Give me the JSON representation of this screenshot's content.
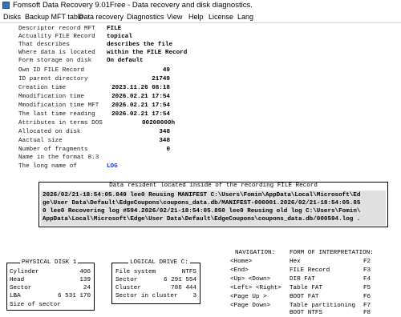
{
  "window": {
    "title": "Fomsoft Data Recovery 9.01Free - Data recovery and disk diagnostics."
  },
  "menu": [
    "Disks",
    "Backup MFT table",
    "Data recovery",
    "Diagnostics",
    "View",
    "Help",
    "License",
    "Lang"
  ],
  "record": {
    "descriptor_record_mft": {
      "label": "Descriptor record MFT",
      "value": "FILE"
    },
    "actuality": {
      "label": "Actuality FILE Record",
      "value": "topical"
    },
    "that_describes": {
      "label": "That describes",
      "value": "describes the file"
    },
    "where_located": {
      "label": "Where data is located",
      "value": "within the FILE Record"
    },
    "form_storage": {
      "label": "Form storage on disk",
      "value": "On default"
    },
    "own_id": {
      "label": "Own ID FILE Record",
      "value": "49"
    },
    "parent_dir": {
      "label": "ID parent directory",
      "value": "21749"
    },
    "creation_time": {
      "label": "Creation time",
      "value": "2023.11.26 08:18"
    },
    "mod_time": {
      "label": "Mmodification time",
      "value": "2026.02.21 17:54"
    },
    "mod_time_mft": {
      "label": "Mmodification time MFT",
      "value": "2026.02.21 17:54"
    },
    "last_reading": {
      "label": "The last time reading",
      "value": "2026.02.21 17:54"
    },
    "attributes_dos": {
      "label": "Attributes in terms DOS",
      "value": "00200000h"
    },
    "allocated": {
      "label": "Allocated on disk",
      "value": "348"
    },
    "actual_size": {
      "label": "Aactual size",
      "value": "348"
    },
    "fragments": {
      "label": "Number of fragments",
      "value": "0"
    },
    "name_8_3": {
      "label": "Name in the format 8.3",
      "value": ""
    },
    "long_name": {
      "label": "The long name of",
      "value": "LOG"
    }
  },
  "resident": {
    "header": "Data resident located inside of the recording FILE Record",
    "lines": [
      "2026/02/21-18:54:05.849 lee0 Reusing MANIFEST C:\\Users\\Fomin\\AppData\\Local\\Microsoft\\Ed",
      "ge\\User Data\\Default\\EdgeCoupons\\coupons_data.db/MANIFEST-000001.2026/02/21-18:54:05.85",
      "0 lee0 Recovering log #594.2026/02/21-18:54:05.850 lee0 Reusing old log C:\\Users\\Fomin\\",
      "AppData\\Local\\Microsoft\\Edge\\User Data\\Default\\EdgeCoupons\\coupons_data.db/000594.log ."
    ]
  },
  "physical_disk": {
    "title": "PHYSICAL DISK  1",
    "rows": [
      {
        "label": "Cylinder",
        "value": "406"
      },
      {
        "label": "Head",
        "value": "139"
      },
      {
        "label": "Sector",
        "value": "24"
      },
      {
        "label": "LBA",
        "value": "6 531 170"
      }
    ],
    "footer": "Size of sector"
  },
  "logical_drive": {
    "title": "LOGICAL DRIVE C:",
    "rows": [
      {
        "label": "File system",
        "value": "NTFS"
      },
      {
        "label": "Sector",
        "value": "6 291 554"
      },
      {
        "label": "Cluster",
        "value": "786 444"
      },
      {
        "label": "Sector in cluster",
        "value": "3"
      }
    ]
  },
  "navigation": {
    "title": "NAVIGATION:",
    "keys": [
      "<Home>",
      "<End>",
      "<Up>   <Down>",
      "<Left> <Right>",
      "<Page Up >",
      "<Page Down>"
    ]
  },
  "interpretation": {
    "title": "FORM OF INTERPRETATION:",
    "items": [
      {
        "label": "Hex",
        "key": "F2"
      },
      {
        "label": "FILE Record",
        "key": "F3"
      },
      {
        "label": "DIR FAT",
        "key": "F4"
      },
      {
        "label": "Table FAT",
        "key": "F5"
      },
      {
        "label": "BOOT FAT",
        "key": "F6"
      },
      {
        "label": "Table partitioning",
        "key": "F7"
      },
      {
        "label": "BOOT NTFS",
        "key": "F8"
      }
    ]
  },
  "colors": {
    "accent_blue": "#1a35c8",
    "resident_bg": "#e0e0e0"
  }
}
